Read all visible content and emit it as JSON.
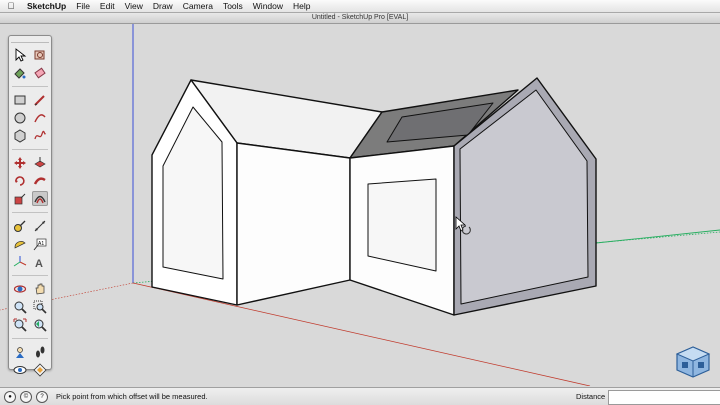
{
  "menubar": {
    "app_name": "SketchUp",
    "items": [
      "File",
      "Edit",
      "View",
      "Draw",
      "Camera",
      "Tools",
      "Window",
      "Help"
    ]
  },
  "window": {
    "title": "Untitled - SketchUp Pro [EVAL]"
  },
  "toolbar": {
    "tools": [
      "select",
      "component",
      "paint-bucket",
      "eraser",
      "rectangle",
      "line",
      "circle",
      "arc",
      "polygon",
      "freehand",
      "move",
      "push-pull",
      "rotate",
      "follow-me",
      "scale",
      "offset",
      "tape-measure",
      "dimension",
      "protractor",
      "text",
      "axes",
      "3d-text",
      "orbit",
      "pan",
      "zoom",
      "zoom-window",
      "zoom-extents",
      "previous",
      "position-camera",
      "walk",
      "look-around",
      "section-plane"
    ],
    "active_tool": "offset"
  },
  "status": {
    "message": "Pick point from which offset will be measured.",
    "measurement_label": "Distance",
    "measurement_value": ""
  },
  "colors": {
    "background": "#d9d9d9",
    "axis_red": "#c0392b",
    "axis_green": "#27ae60",
    "axis_blue": "#3b4fd6",
    "roof_shade": "#7c7c7c",
    "selected_face": "#a9a9b3"
  }
}
